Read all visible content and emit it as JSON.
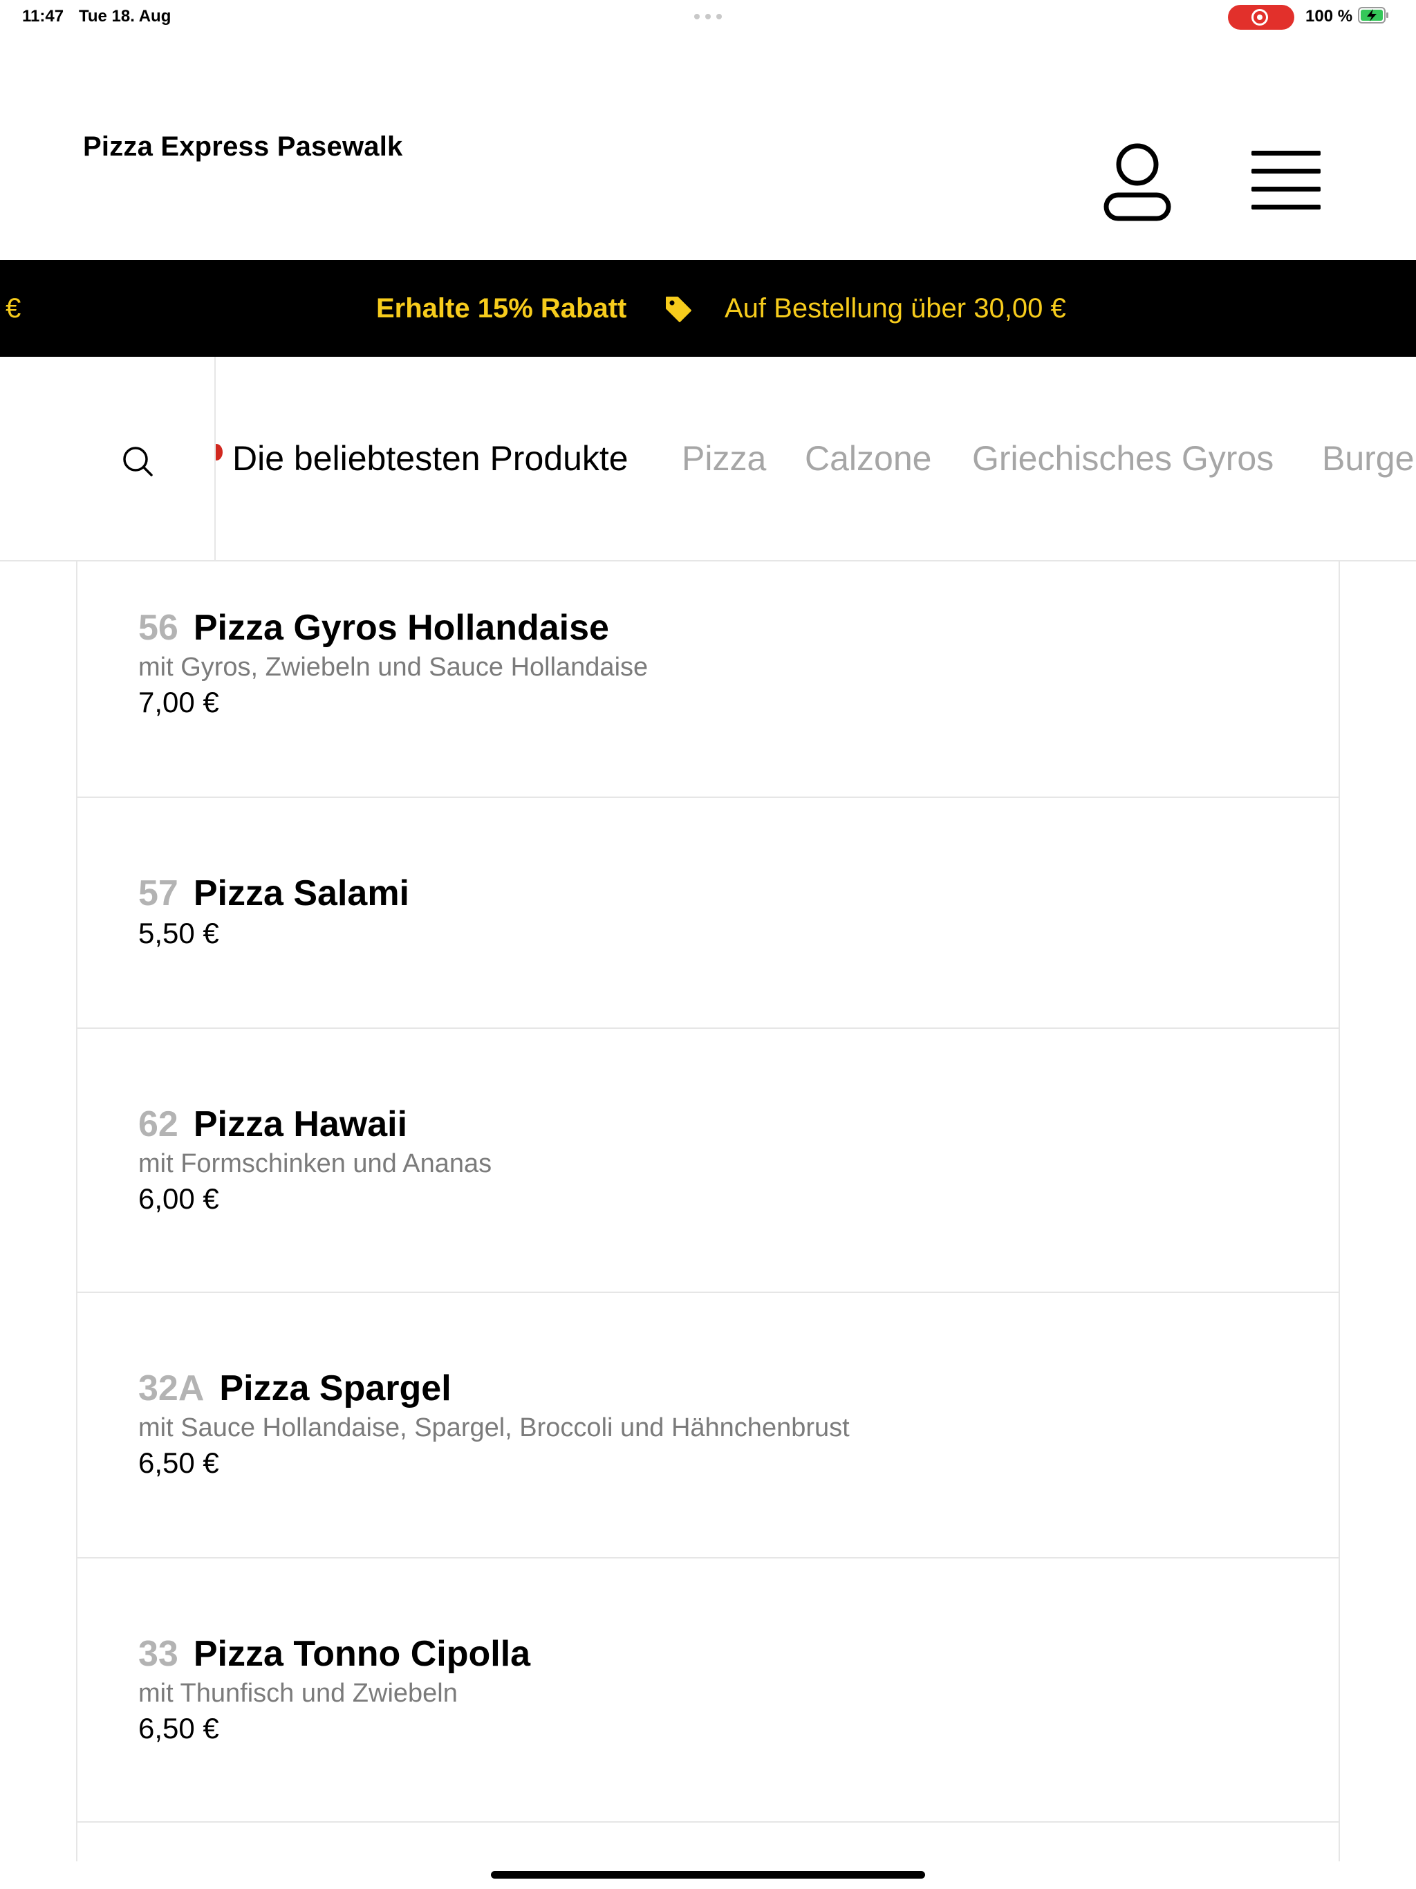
{
  "status_bar": {
    "time": "11:47",
    "date": "Tue 18. Aug",
    "battery_percent": "100 %",
    "recording_indicator": "screen-recording",
    "battery_charging": true,
    "battery_level": 1.0
  },
  "header": {
    "shop_name": "Pizza Express Pasewalk",
    "profile_icon": "user-icon",
    "menu_icon": "hamburger-menu-icon"
  },
  "promo": {
    "left_fragment": "€",
    "discount_text": "Erhalte 15% Rabatt",
    "tag_icon": "price-tag-icon",
    "condition_text": "Auf Bestellung über 30,00 €",
    "text_color": "#f7cc1c",
    "background_color": "#000000"
  },
  "categories": {
    "search_icon": "search-icon",
    "tabs": [
      {
        "label": "Die beliebtesten Produkte",
        "active": true
      },
      {
        "label": "Pizza",
        "active": false
      },
      {
        "label": "Calzone",
        "active": false
      },
      {
        "label": "Griechisches Gyros",
        "active": false
      },
      {
        "label": "Burge",
        "active": false
      }
    ]
  },
  "products": [
    {
      "number": "56",
      "name": "Pizza Gyros Hollandaise",
      "description": "mit Gyros, Zwiebeln und Sauce Hollandaise",
      "price": "7,00 €"
    },
    {
      "number": "57",
      "name": "Pizza Salami",
      "description": "",
      "price": "5,50 €"
    },
    {
      "number": "62",
      "name": "Pizza Hawaii",
      "description": "mit Formschinken und Ananas",
      "price": "6,00 €"
    },
    {
      "number": "32A",
      "name": "Pizza Spargel",
      "description": "mit Sauce Hollandaise, Spargel, Broccoli und Hähnchenbrust",
      "price": "6,50 €"
    },
    {
      "number": "33",
      "name": "Pizza Tonno Cipolla",
      "description": "mit Thunfisch und Zwiebeln",
      "price": "6,50 €"
    }
  ]
}
